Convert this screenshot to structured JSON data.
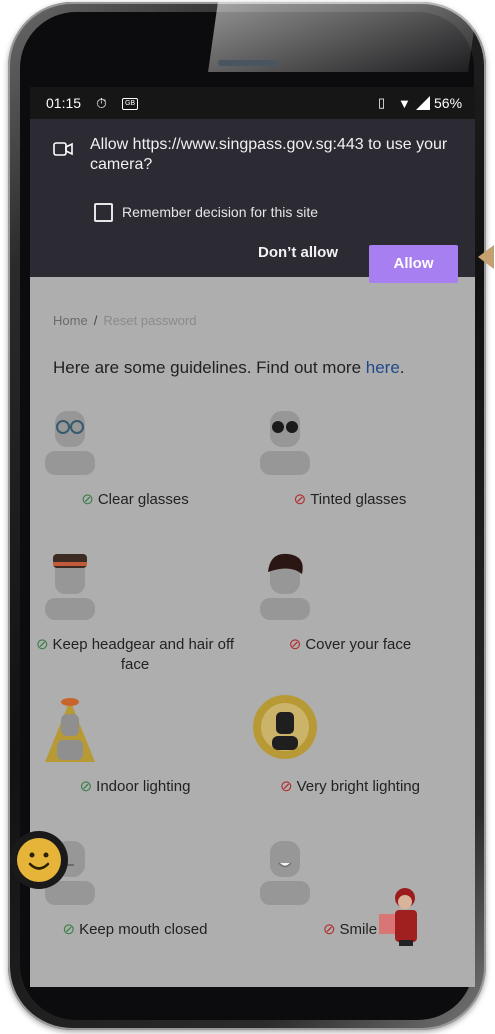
{
  "status_bar": {
    "time": "01:15",
    "battery": "56%",
    "icons": [
      "timer-icon",
      "message-icon",
      "vibrate-icon",
      "wifi-icon",
      "signal-icon"
    ]
  },
  "permission_dialog": {
    "prompt": "Allow https://www.singpass.gov.sg:443 to use your camera?",
    "remember_label": "Remember decision for this site",
    "deny_label": "Don’t allow",
    "allow_label": "Allow",
    "colors": {
      "background": "#2c2a33",
      "allow": "#a77ff1"
    }
  },
  "breadcrumb": {
    "home": "Home",
    "separator": "/",
    "current": "Reset password"
  },
  "intro": {
    "text": "Here are some guidelines. Find out more ",
    "link": "here",
    "end": "."
  },
  "guidelines": [
    {
      "label": "Clear glasses",
      "ok": true
    },
    {
      "label": "Tinted glasses",
      "ok": false
    },
    {
      "label": "Keep headgear and hair off face",
      "ok": true
    },
    {
      "label": "Cover your face",
      "ok": false
    },
    {
      "label": "Indoor lighting",
      "ok": true
    },
    {
      "label": "Very bright lighting",
      "ok": false
    },
    {
      "label": "Keep mouth closed",
      "ok": true
    },
    {
      "label": "Smile",
      "ok": false
    }
  ]
}
